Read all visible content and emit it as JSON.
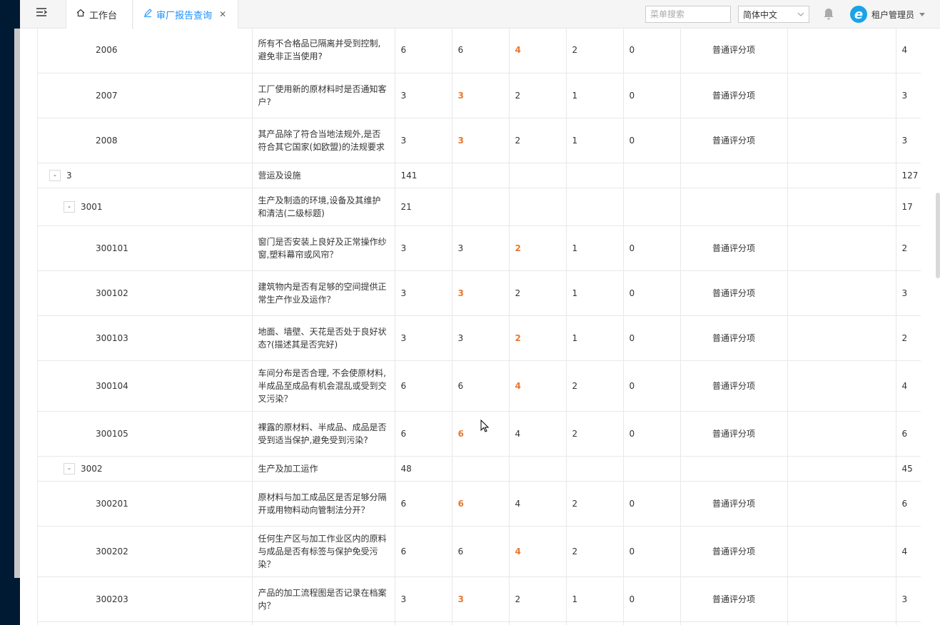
{
  "topbar": {
    "tabs": [
      {
        "label": "工作台",
        "icon": "home-icon"
      },
      {
        "label": "审厂报告查询",
        "icon": "edit-icon"
      }
    ],
    "search_placeholder": "菜单搜索",
    "language": "简体中文",
    "user_name": "租户管理员",
    "avatar_letter": "e"
  },
  "colors": {
    "highlight": "#e8782d",
    "active_tab": "#1890ff",
    "sidebar": "#001a33"
  },
  "rows": [
    {
      "code": "2006",
      "level": 2,
      "toggle": "",
      "title": "所有不合格品已隔离并受到控制,避免非正当使用?",
      "c1": "6",
      "c2": "6",
      "c3": "4",
      "c4": "2",
      "c5": "0",
      "type": "普通评分项",
      "extra": "",
      "score": "4",
      "hl": 3,
      "h": 63
    },
    {
      "code": "2007",
      "level": 2,
      "toggle": "",
      "title": "工厂使用新的原材料时是否通知客户?",
      "c1": "3",
      "c2": "3",
      "c3": "2",
      "c4": "1",
      "c5": "0",
      "type": "普通评分项",
      "extra": "",
      "score": "3",
      "hl": 2,
      "h": 63
    },
    {
      "code": "2008",
      "level": 2,
      "toggle": "",
      "title": "其产品除了符合当地法规外,是否符合其它国家(如欧盟)的法规要求",
      "c1": "3",
      "c2": "3",
      "c3": "2",
      "c4": "1",
      "c5": "0",
      "type": "普通评分项",
      "extra": "",
      "score": "3",
      "hl": 2,
      "h": 63
    },
    {
      "code": "3",
      "level": 0,
      "toggle": "-",
      "title": "营运及设施",
      "c1": "141",
      "c2": "",
      "c3": "",
      "c4": "",
      "c5": "",
      "type": "",
      "extra": "",
      "score": "127",
      "hl": 0,
      "h": 35
    },
    {
      "code": "3001",
      "level": 1,
      "toggle": "-",
      "title": "生产及制造的环境,设备及其维护和清洁(二级标题)",
      "c1": "21",
      "c2": "",
      "c3": "",
      "c4": "",
      "c5": "",
      "type": "",
      "extra": "",
      "score": "17",
      "hl": 0,
      "h": 53
    },
    {
      "code": "300101",
      "level": 2,
      "toggle": "",
      "title": "窗门是否安装上良好及正常操作纱窗,塑料幕帘或风帘？",
      "c1": "3",
      "c2": "3",
      "c3": "2",
      "c4": "1",
      "c5": "0",
      "type": "普通评分项",
      "extra": "",
      "score": "2",
      "hl": 3,
      "h": 63
    },
    {
      "code": "300102",
      "level": 2,
      "toggle": "",
      "title": "建筑物内是否有足够的空间提供正常生产作业及运作？",
      "c1": "3",
      "c2": "3",
      "c3": "2",
      "c4": "1",
      "c5": "0",
      "type": "普通评分项",
      "extra": "",
      "score": "3",
      "hl": 2,
      "h": 63
    },
    {
      "code": "300103",
      "level": 2,
      "toggle": "",
      "title": "地面、墙壁、天花是否处于良好状态?(描述其是否完好)",
      "c1": "3",
      "c2": "3",
      "c3": "2",
      "c4": "1",
      "c5": "0",
      "type": "普通评分项",
      "extra": "",
      "score": "2",
      "hl": 3,
      "h": 63
    },
    {
      "code": "300104",
      "level": 2,
      "toggle": "",
      "title": "车间分布是否合理, 不会使原材料,半成品至成品有机会混乱或受到交叉污染？",
      "c1": "6",
      "c2": "6",
      "c3": "4",
      "c4": "2",
      "c5": "0",
      "type": "普通评分项",
      "extra": "",
      "score": "4",
      "hl": 3,
      "h": 71
    },
    {
      "code": "300105",
      "level": 2,
      "toggle": "",
      "title": "裸露的原材料、半成品、成品是否受到适当保护,避免受到污染?",
      "c1": "6",
      "c2": "6",
      "c3": "4",
      "c4": "2",
      "c5": "0",
      "type": "普通评分项",
      "extra": "",
      "score": "6",
      "hl": 2,
      "h": 63
    },
    {
      "code": "3002",
      "level": 1,
      "toggle": "-",
      "title": "生产及加工运作",
      "c1": "48",
      "c2": "",
      "c3": "",
      "c4": "",
      "c5": "",
      "type": "",
      "extra": "",
      "score": "45",
      "hl": 0,
      "h": 35
    },
    {
      "code": "300201",
      "level": 2,
      "toggle": "",
      "title": "原材料与加工成品区是否足够分隔开或用物料动向管制法分开？",
      "c1": "6",
      "c2": "6",
      "c3": "4",
      "c4": "2",
      "c5": "0",
      "type": "普通评分项",
      "extra": "",
      "score": "6",
      "hl": 2,
      "h": 63
    },
    {
      "code": "300202",
      "level": 2,
      "toggle": "",
      "title": "任何生产区与加工作业区内的原料与成品是否有标签与保护免受污染？",
      "c1": "6",
      "c2": "6",
      "c3": "4",
      "c4": "2",
      "c5": "0",
      "type": "普通评分项",
      "extra": "",
      "score": "4",
      "hl": 3,
      "h": 71
    },
    {
      "code": "300203",
      "level": 2,
      "toggle": "",
      "title": "产品的加工流程图是否记录在档案内？",
      "c1": "3",
      "c2": "3",
      "c3": "2",
      "c4": "1",
      "c5": "0",
      "type": "普通评分项",
      "extra": "",
      "score": "3",
      "hl": 2,
      "h": 63
    },
    {
      "code": "",
      "level": 2,
      "toggle": "",
      "title": "",
      "c1": "",
      "c2": "",
      "c3": "",
      "c4": "",
      "c5": "",
      "type": "",
      "extra": "",
      "score": "",
      "hl": 0,
      "h": 40
    }
  ]
}
